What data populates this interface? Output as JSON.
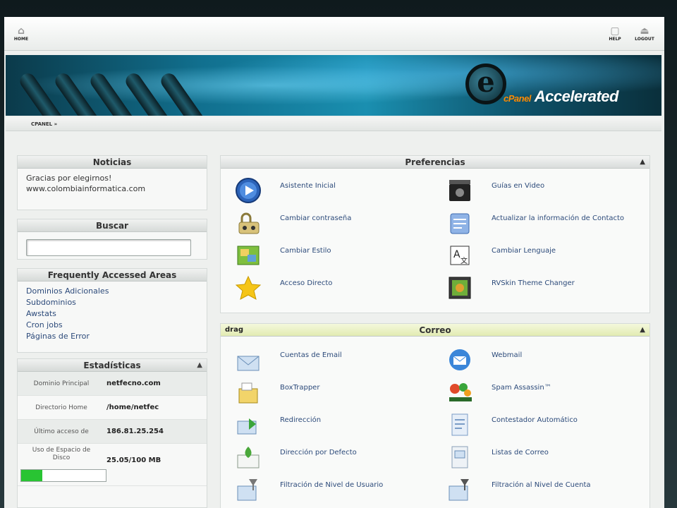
{
  "topbar": {
    "home_label": "HOME",
    "help_label": "HELP",
    "logout_label": "LOGOUT"
  },
  "banner": {
    "logo_letter": "e",
    "logo_brand_c": "cPanel",
    "logo_brand_text": "Accelerated"
  },
  "breadcrumb": {
    "label": "CPANEL »"
  },
  "noticias": {
    "title": "Noticias",
    "line1": "Gracias por elegirnos!",
    "line2": "www.colombiainformatica.com"
  },
  "buscar": {
    "title": "Buscar",
    "value": ""
  },
  "frequent": {
    "title": "Frequently Accessed Areas",
    "links": [
      "Dominios Adicionales",
      "Subdominios",
      "Awstats",
      "Cron jobs",
      "Páginas de Error"
    ]
  },
  "stats": {
    "title": "Estadísticas",
    "rows": [
      {
        "key": "Dominio Principal",
        "value": "netfecno.com"
      },
      {
        "key": "Directorio Home",
        "value": "/home/netfec"
      },
      {
        "key": "Último acceso de",
        "value": "186.81.25.254"
      },
      {
        "key": "Uso de Espacio de Disco",
        "value": "25.05/100 MB"
      }
    ],
    "disk_fraction": 0.25
  },
  "preferencias": {
    "title": "Preferencias",
    "items": [
      {
        "label": "Asistente Inicial",
        "icon": "play-icon"
      },
      {
        "label": "Guías en Video",
        "icon": "video-icon"
      },
      {
        "label": "Cambiar contraseña",
        "icon": "password-icon"
      },
      {
        "label": "Actualizar la información de Contacto",
        "icon": "contact-icon"
      },
      {
        "label": "Cambiar Estilo",
        "icon": "style-icon"
      },
      {
        "label": "Cambiar Lenguaje",
        "icon": "language-icon"
      },
      {
        "label": "Acceso Directo",
        "icon": "star-icon"
      },
      {
        "label": "RVSkin Theme Changer",
        "icon": "theme-icon"
      }
    ]
  },
  "correo": {
    "title": "Correo",
    "drag_label": "drag",
    "items": [
      {
        "label": "Cuentas de Email",
        "icon": "email-accounts-icon"
      },
      {
        "label": "Webmail",
        "icon": "webmail-icon"
      },
      {
        "label": "BoxTrapper",
        "icon": "boxtrapper-icon"
      },
      {
        "label": "Spam Assassin™",
        "icon": "spam-assassin-icon"
      },
      {
        "label": "Redirección",
        "icon": "forwarder-icon"
      },
      {
        "label": "Contestador Automático",
        "icon": "autoresponder-icon"
      },
      {
        "label": "Dirección por Defecto",
        "icon": "default-address-icon"
      },
      {
        "label": "Listas de Correo",
        "icon": "mailing-list-icon"
      },
      {
        "label": "Filtración de Nivel de Usuario",
        "icon": "user-filter-icon"
      },
      {
        "label": "Filtración al Nivel de Cuenta",
        "icon": "account-filter-icon"
      }
    ]
  }
}
